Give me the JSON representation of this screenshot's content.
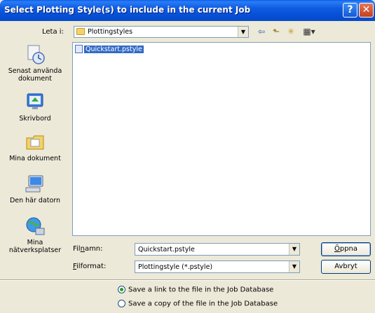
{
  "window": {
    "title": "Select Plotting Style(s) to include in the current Job",
    "help_label": "?",
    "close_label": "✕"
  },
  "lookin": {
    "label": "Leta i:",
    "value": "Plottingstyles",
    "arrow": "▼"
  },
  "toolbar": {
    "back_icon": "⇦",
    "up_icon": "⬑",
    "new_folder_icon": "✳",
    "view_icon": "▦▾"
  },
  "places": [
    {
      "label": "Senast använda dokument",
      "icon": "recent-documents-icon"
    },
    {
      "label": "Skrivbord",
      "icon": "desktop-icon"
    },
    {
      "label": "Mina dokument",
      "icon": "my-documents-icon"
    },
    {
      "label": "Den här datorn",
      "icon": "my-computer-icon"
    },
    {
      "label": "Mina nätverksplatser",
      "icon": "network-places-icon"
    }
  ],
  "files": [
    {
      "name": "Quickstart.pstyle",
      "selected": true
    }
  ],
  "filename": {
    "label_prefix": "Fil",
    "label_underlined": "n",
    "label_suffix": "amn:",
    "value": "Quickstart.pstyle"
  },
  "filetype": {
    "label_underlined": "F",
    "label_suffix": "ilformat:",
    "value": "Plottingstyle (*.pstyle)"
  },
  "buttons": {
    "open_underlined": "Ö",
    "open_suffix": "ppna",
    "cancel": "Avbryt"
  },
  "options": [
    {
      "label": "Save a link to the file in the Job Database",
      "checked": true
    },
    {
      "label": "Save a copy of the file in the Job Database",
      "checked": false
    }
  ],
  "colors": {
    "titlebar": "#0a5ee9",
    "selection": "#316ac5",
    "dialog_bg": "#ece9d8"
  }
}
